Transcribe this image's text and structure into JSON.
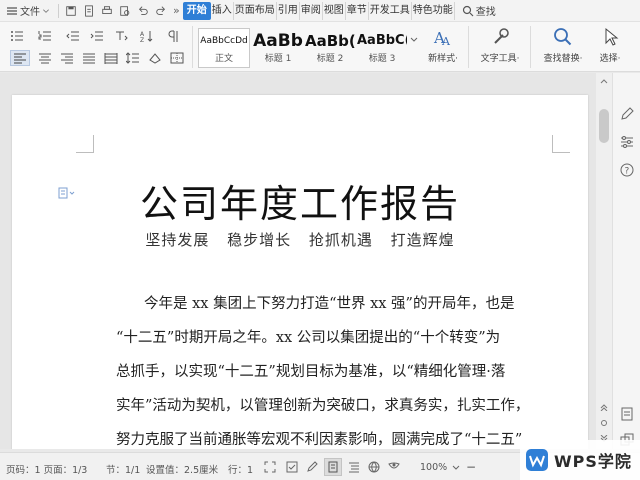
{
  "topbar": {
    "file_menu": "文件",
    "tabs": [
      "开始",
      "插入",
      "页面布局",
      "引用",
      "审阅",
      "视图",
      "章节",
      "开发工具",
      "特色功能"
    ],
    "search_label": "查找"
  },
  "ribbon": {
    "styles": [
      {
        "sample": "AaBbCcDd",
        "label": "正文"
      },
      {
        "sample": "AaBb",
        "label": "标题 1"
      },
      {
        "sample": "AaBb(",
        "label": "标题 2"
      },
      {
        "sample": "AaBbC(",
        "label": "标题 3"
      }
    ],
    "new_style": "新样式·",
    "text_tools": "文字工具·",
    "find_replace": "查找替换·",
    "select": "选择·"
  },
  "document": {
    "title": "公司年度工作报告",
    "subtitle": "坚持发展  稳步增长  抢抓机遇  打造辉煌",
    "paragraph_lines": [
      "今年是 xx 集团上下努力打造“世界 xx 强”的开局年，也是",
      "“十二五”时期开局之年。xx 公司以集团提出的“十个转变”为",
      "总抓手，以实现“十二五”规划目标为基准，以“精细化管理·落",
      "实年”活动为契机，以管理创新为突破口，求真务实，扎实工作，",
      "努力克服了当前通胀等宏观不利因素影响，圆满完成了“十二五”"
    ]
  },
  "statusbar": {
    "page_info": "页码：1  页面：1/3",
    "section": "节：1/1",
    "setting": "设置值：2.5厘米",
    "row": "行：1",
    "zoom": "100%"
  },
  "badge": {
    "text": "WPS学院",
    "accent": "#2f7fd6"
  }
}
